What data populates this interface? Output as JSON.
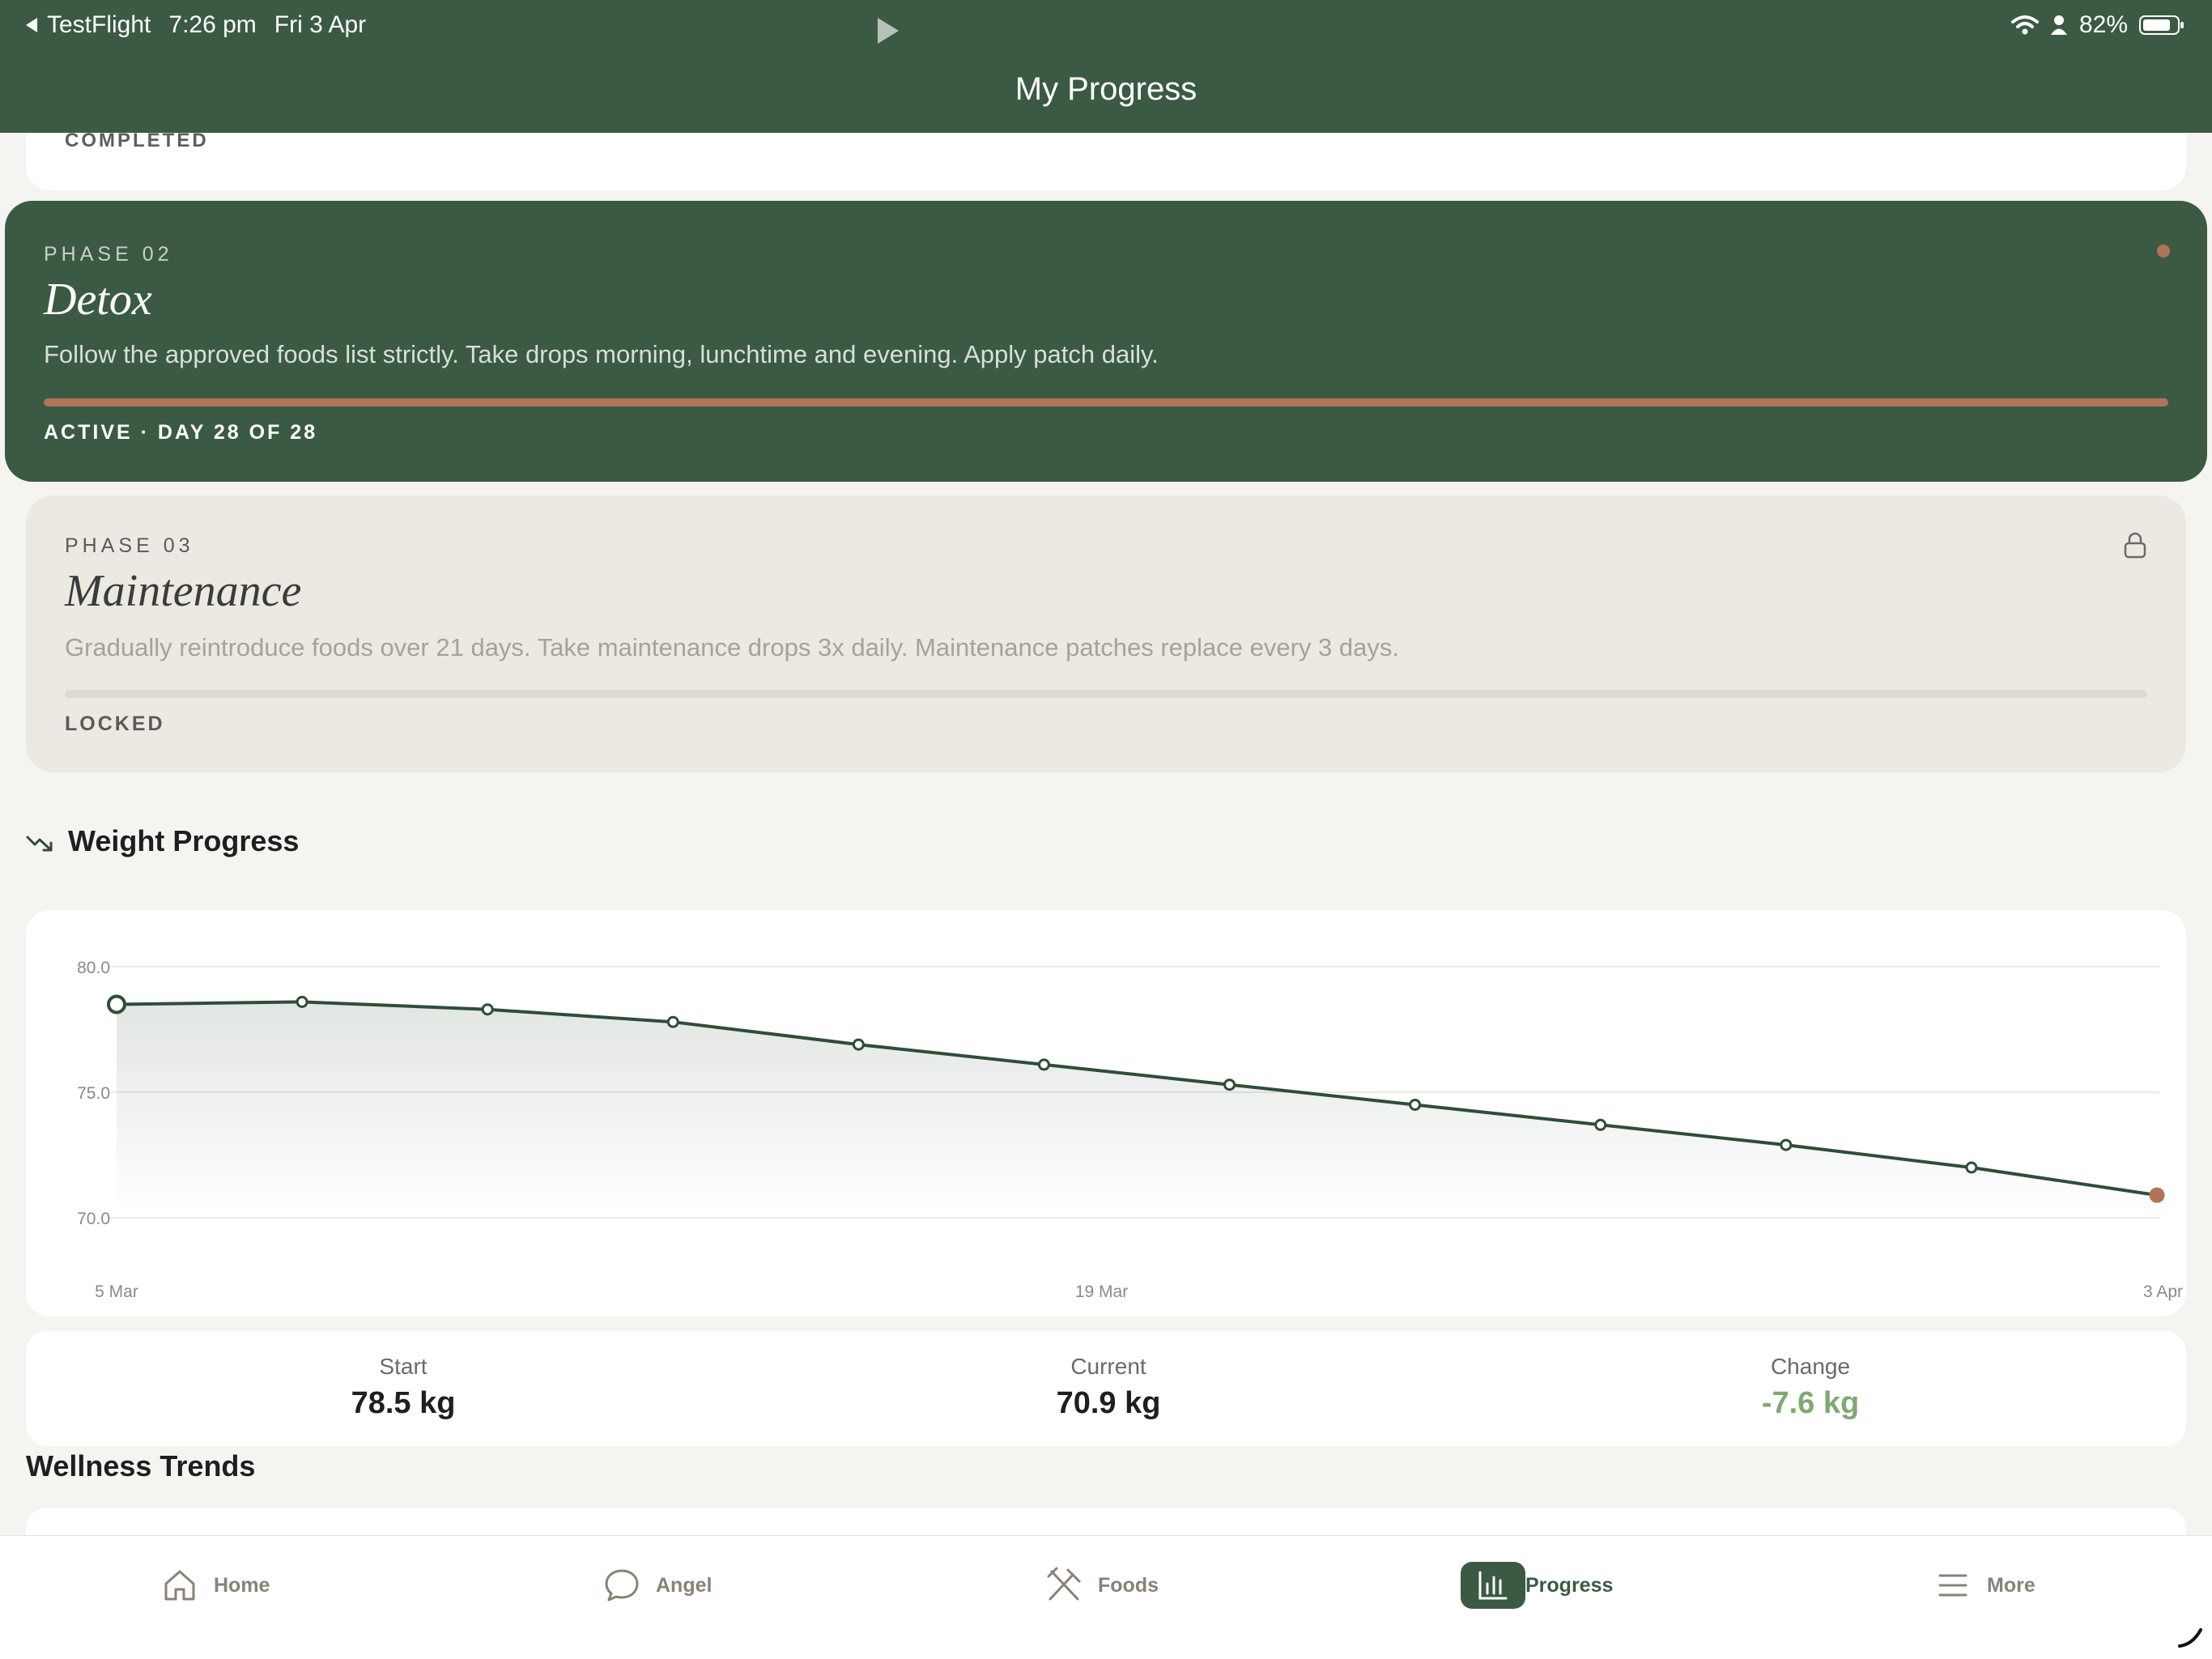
{
  "status_bar": {
    "back_app": "TestFlight",
    "time": "7:26 pm",
    "date": "Fri 3 Apr",
    "battery": "82%"
  },
  "header": {
    "title": "My Progress"
  },
  "phases": {
    "completed": {
      "status": "COMPLETED"
    },
    "active": {
      "label": "PHASE 02",
      "name": "Detox",
      "description": "Follow the approved foods list strictly. Take drops morning, lunchtime and evening. Apply patch daily.",
      "status": "ACTIVE · DAY 28 OF 28",
      "progress": 1.0
    },
    "locked": {
      "label": "PHASE 03",
      "name": "Maintenance",
      "description": "Gradually reintroduce foods over 21 days. Take maintenance drops 3x daily. Maintenance patches replace every 3 days.",
      "status": "LOCKED",
      "progress": 0
    }
  },
  "weight": {
    "section_title": "Weight Progress",
    "stats": {
      "start_label": "Start",
      "start_value": "78.5 kg",
      "current_label": "Current",
      "current_value": "70.9 kg",
      "change_label": "Change",
      "change_value": "-7.6 kg"
    }
  },
  "chart_data": {
    "type": "line",
    "title": "",
    "xlabel": "",
    "ylabel": "",
    "x_ticks": [
      "5 Mar",
      "19 Mar",
      "3 Apr"
    ],
    "y_ticks": [
      "80.0",
      "75.0",
      "70.0"
    ],
    "ylim": [
      70,
      80
    ],
    "series": [
      {
        "values": [
          78.5,
          78.6,
          78.3,
          77.8,
          76.9,
          76.1,
          75.3,
          74.5,
          73.7,
          72.9,
          72.0,
          70.9
        ]
      }
    ],
    "grid": true,
    "line_color": "#2f4d37",
    "last_point_color": "#b07459"
  },
  "wellness": {
    "section_title": "Wellness Trends"
  },
  "tabbar": {
    "items": [
      {
        "label": "Home",
        "icon": "home-icon"
      },
      {
        "label": "Angel",
        "icon": "chat-bubble-icon"
      },
      {
        "label": "Foods",
        "icon": "utensils-icon"
      },
      {
        "label": "Progress",
        "icon": "bar-chart-icon",
        "active": true
      },
      {
        "label": "More",
        "icon": "menu-icon"
      }
    ]
  },
  "colors": {
    "brand_green": "#3b5a43",
    "accent_terracotta": "#b07459",
    "positive_green": "#7fa873"
  }
}
